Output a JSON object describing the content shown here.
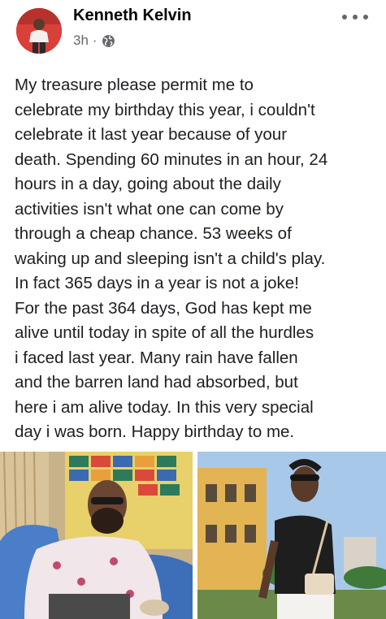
{
  "post": {
    "author": "Kenneth Kelvin",
    "time": "3h",
    "separator": "·",
    "privacy_icon": "globe-icon",
    "menu_icon": "more-options-icon",
    "lines": [
      "My treasure please permit me to",
      "celebrate my birthday this year, i couldn't",
      "celebrate it last year because of your",
      "death. Spending 60 minutes in an hour, 24",
      "hours in a day, going about the daily",
      "activities isn't what one can come by",
      "through a cheap chance. 53 weeks of",
      "waking up and sleeping isn't a child's play.",
      "In fact 365 days in a year is not a joke!",
      "For the past 364 days, God has kept me",
      "alive until today in spite of all the hurdles",
      "i faced last year. Many rain have fallen",
      "and the barren land  had absorbed, but",
      "here i am alive today. In this very special",
      "day i was born. Happy birthday to me."
    ]
  },
  "colors": {
    "text": "#1c1e21",
    "secondary": "#65676b"
  }
}
